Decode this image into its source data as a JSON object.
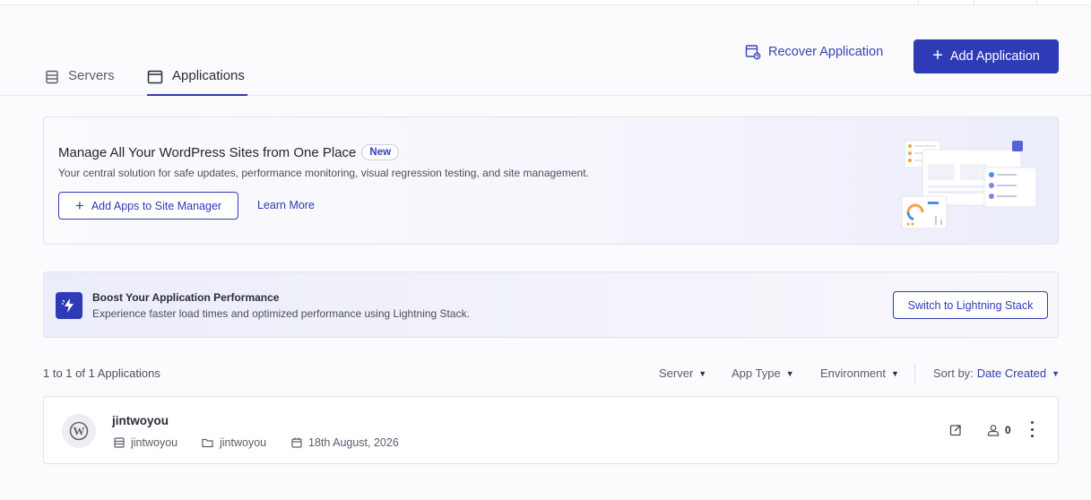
{
  "tabs": [
    {
      "label": "Servers",
      "icon": "server-icon",
      "active": false
    },
    {
      "label": "Applications",
      "icon": "application-window-icon",
      "active": true
    }
  ],
  "header_actions": {
    "recover_label": "Recover Application",
    "add_label": "Add Application"
  },
  "site_manager_banner": {
    "title": "Manage All Your WordPress Sites from One Place",
    "badge": "New",
    "description": "Your central solution for safe updates, performance monitoring, visual regression testing, and site management.",
    "add_button": "Add Apps to Site Manager",
    "learn_more": "Learn More"
  },
  "boost_banner": {
    "title": "Boost Your Application Performance",
    "description": "Experience faster load times and optimized performance using Lightning Stack.",
    "button": "Switch to Lightning Stack"
  },
  "list_toolbar": {
    "count_text": "1 to 1 of 1 Applications",
    "filters": [
      "Server",
      "App Type",
      "Environment"
    ],
    "sort_label": "Sort by:",
    "sort_value": "Date Created"
  },
  "applications": [
    {
      "name": "jintwoyou",
      "server": "jintwoyou",
      "folder": "jintwoyou",
      "created": "18th August, 2026",
      "users": "0"
    }
  ],
  "colors": {
    "accent": "#2f3bb6",
    "border": "#e2e3ea",
    "text": "#2a2d3a"
  }
}
